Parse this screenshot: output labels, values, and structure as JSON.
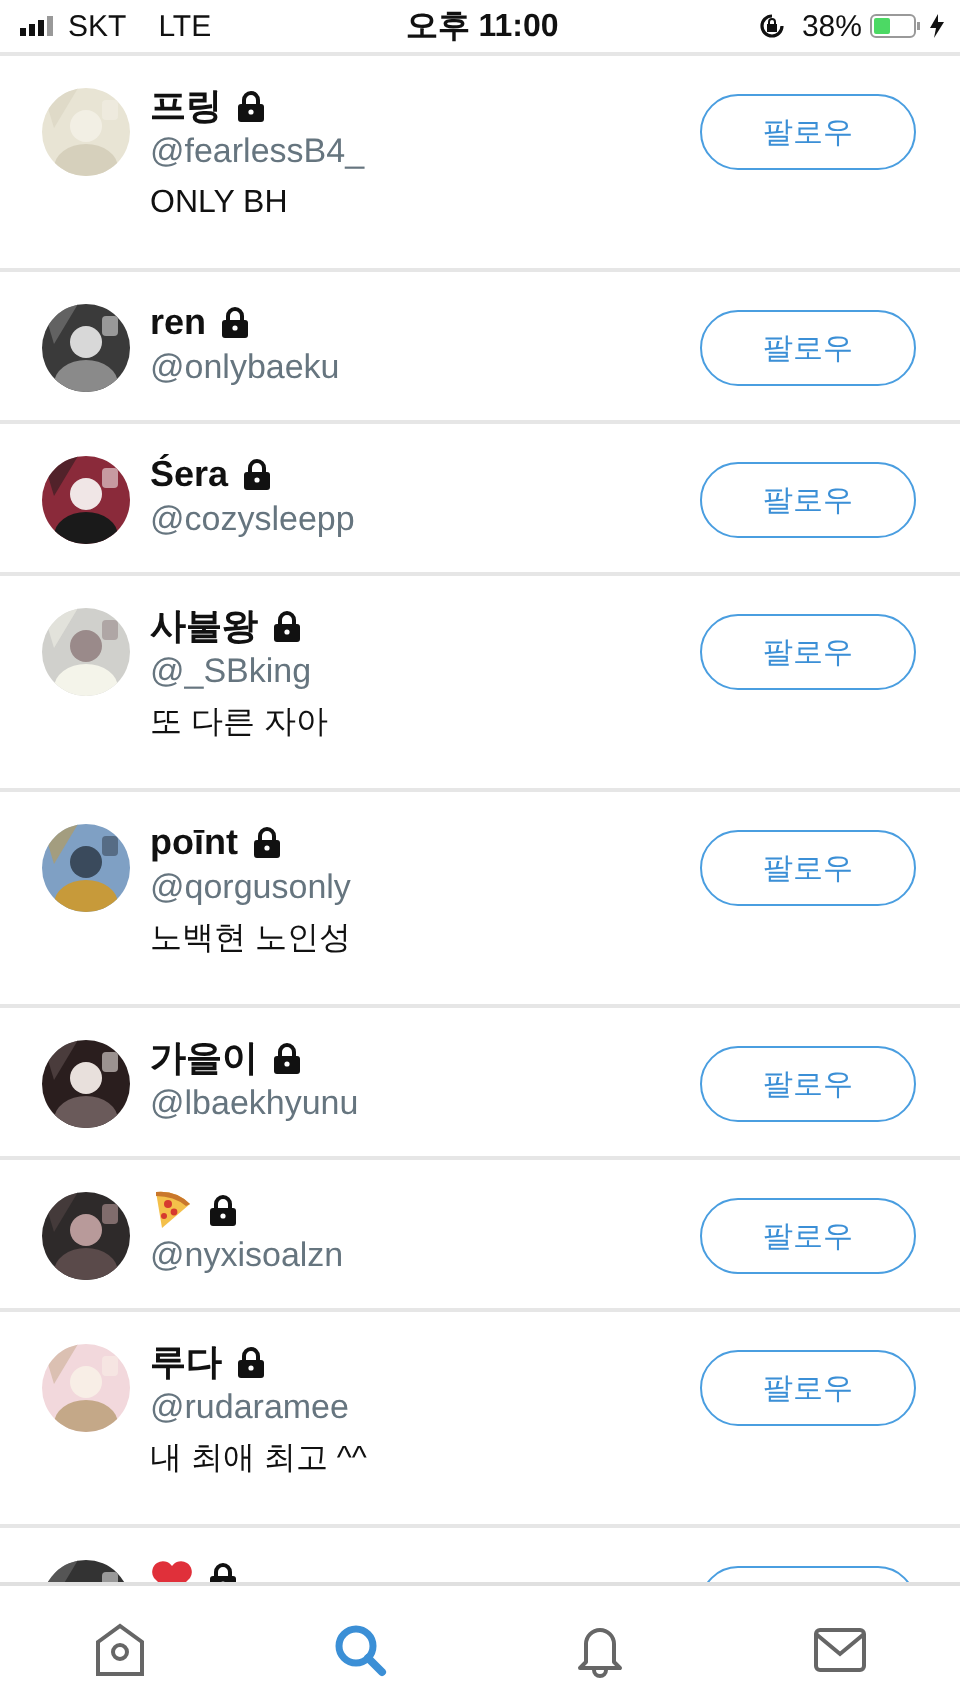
{
  "status_bar": {
    "carrier": "SKT",
    "network": "LTE",
    "time": "오후 11:00",
    "battery": "38%"
  },
  "users": [
    {
      "kind": "full",
      "name": "프링",
      "locked": true,
      "handle": "@fearlessB4_",
      "bio": "ONLY BH",
      "button": "팔로우"
    },
    {
      "kind": "full",
      "name": "ren",
      "locked": true,
      "handle": "@onlybaeku",
      "button": "팔로우"
    },
    {
      "kind": "full",
      "name": "Śera",
      "locked": true,
      "handle": "@cozysleepp",
      "button": "팔로우"
    },
    {
      "kind": "full",
      "name": "사불왕",
      "locked": true,
      "handle": "@_SBking",
      "bio": "또 다른 자아",
      "button": "팔로우"
    },
    {
      "kind": "full",
      "name": "poīnt",
      "locked": true,
      "handle": "@qorgusonly",
      "bio": "노백현 노인성",
      "button": "팔로우"
    },
    {
      "kind": "full",
      "name": "가을이",
      "locked": true,
      "handle": "@lbaekhyunu",
      "button": "팔로우"
    },
    {
      "kind": "pizza",
      "locked": true,
      "handle": "@nyxisoalzn",
      "button": "팔로우"
    },
    {
      "kind": "full",
      "name": "루다",
      "locked": true,
      "handle": "@rudaramee",
      "bio": "내 최애 최고 ^^",
      "button": "팔로우"
    },
    {
      "kind": "heart",
      "locked": true
    }
  ],
  "tabs": [
    {
      "selected": false
    },
    {
      "selected": true
    },
    {
      "selected": false
    },
    {
      "selected": false
    }
  ]
}
